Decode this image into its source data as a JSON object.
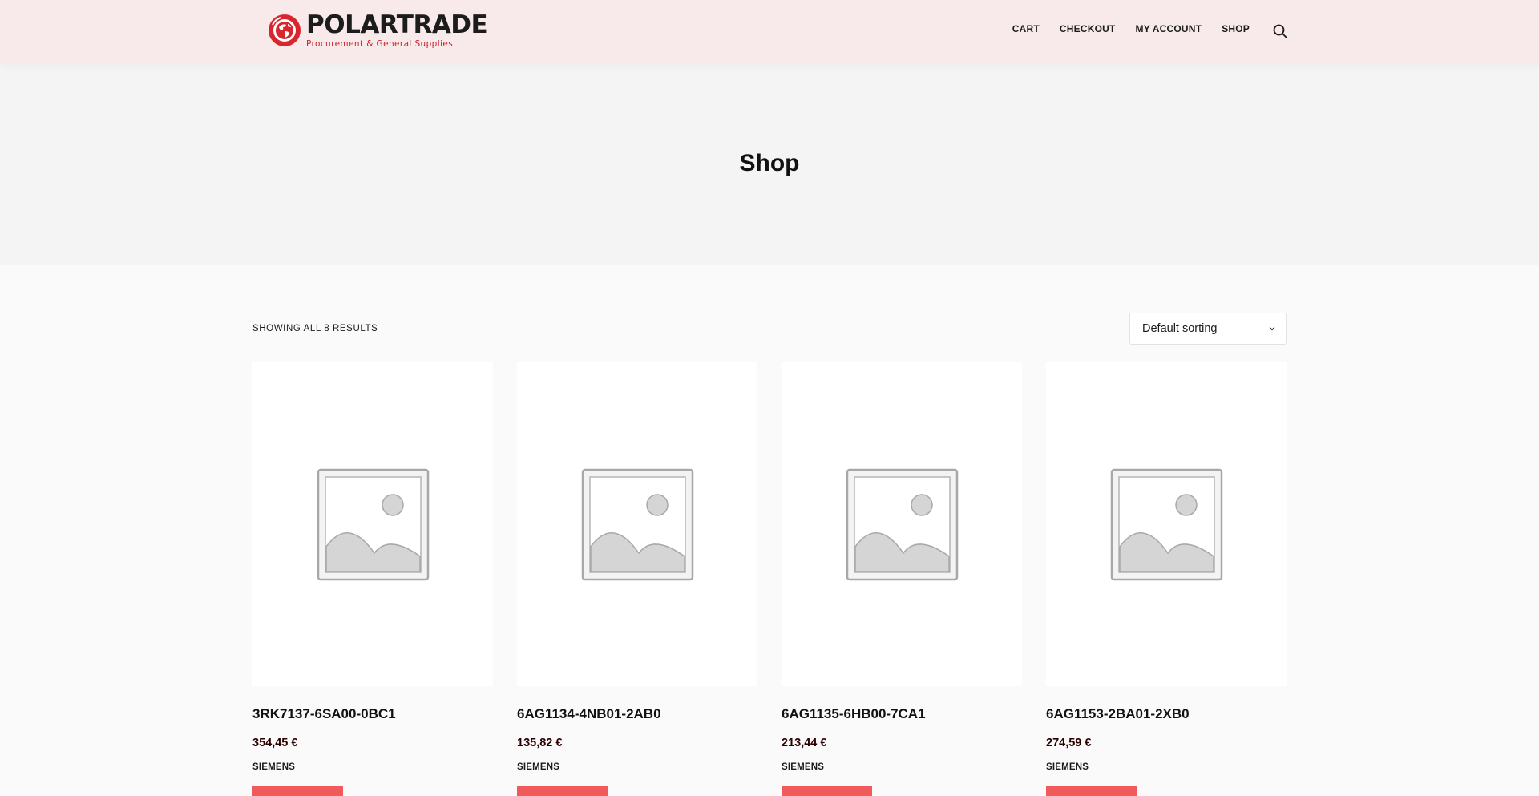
{
  "header": {
    "logo_name": "POLARTRADE",
    "logo_tagline": "Procurement & General Supplies",
    "nav": [
      {
        "label": "CART"
      },
      {
        "label": "CHECKOUT"
      },
      {
        "label": "MY ACCOUNT"
      },
      {
        "label": "SHOP"
      }
    ],
    "search_icon": "search-icon"
  },
  "hero": {
    "title": "Shop"
  },
  "shop": {
    "results_count": "SHOWING ALL 8 RESULTS",
    "sorting": {
      "selected": "Default sorting",
      "icon": "chevron-down-icon"
    }
  },
  "products": [
    {
      "title": "3RK7137-6SA00-0BC1",
      "price": "354,45 €",
      "brand": "SIEMENS"
    },
    {
      "title": "6AG1134-4NB01-2AB0",
      "price": "135,82 €",
      "brand": "SIEMENS"
    },
    {
      "title": "6AG1135-6HB00-7CA1",
      "price": "213,44 €",
      "brand": "SIEMENS"
    },
    {
      "title": "6AG1153-2BA01-2XB0",
      "price": "274,59 €",
      "brand": "SIEMENS"
    }
  ],
  "colors": {
    "header_bg": "#f8e9ea",
    "hero_bg": "#f4f4f4",
    "accent": "#f05a5a",
    "brand_red": "#c9232c",
    "price": "#2b0000"
  }
}
